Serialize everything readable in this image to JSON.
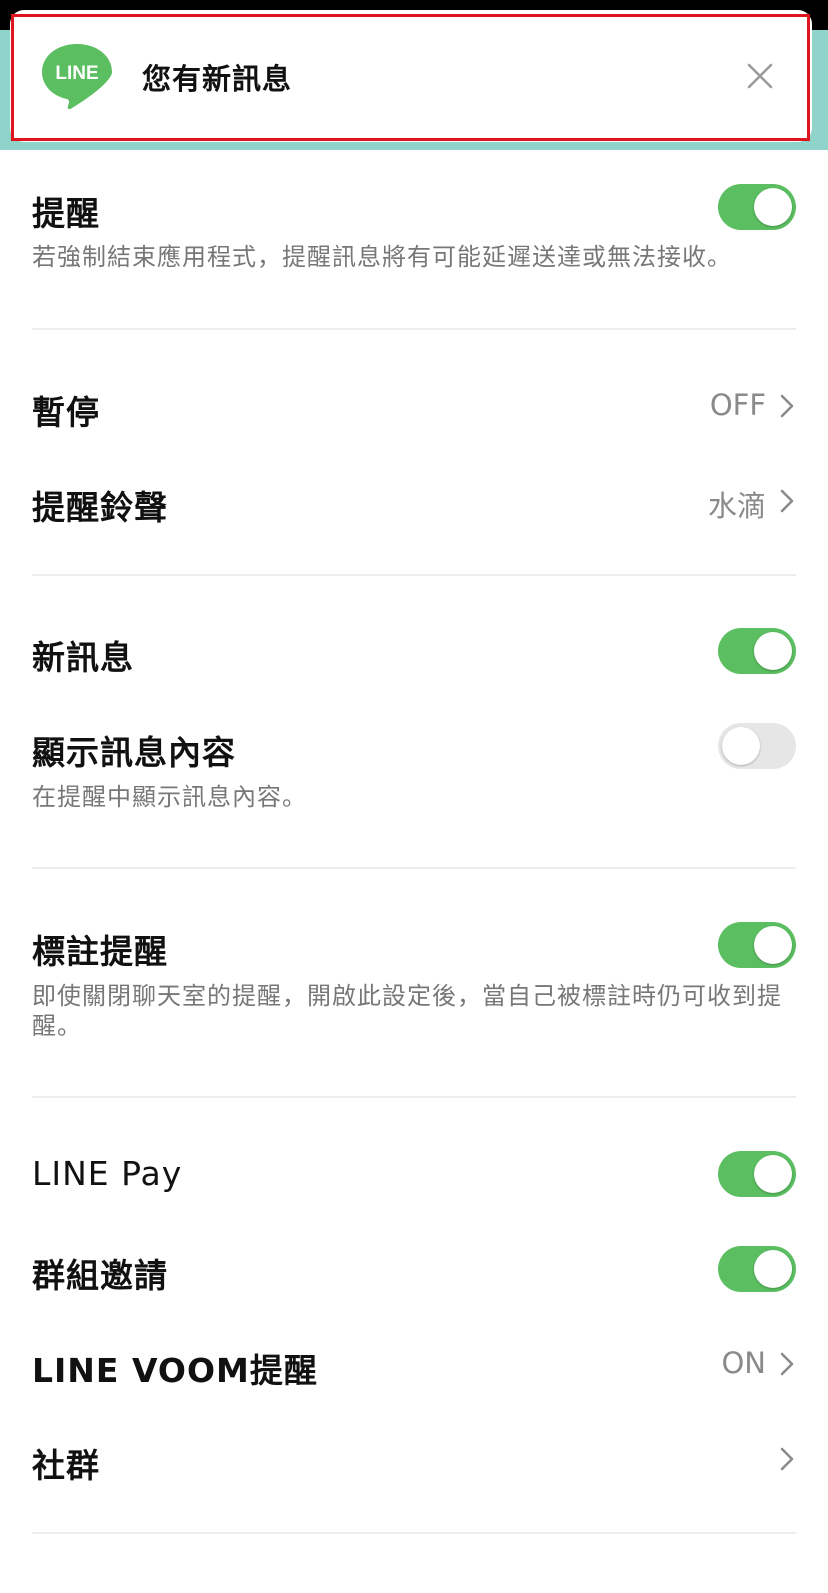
{
  "notification": {
    "app_icon": "line-logo-icon",
    "app_logo_text": "LINE",
    "message": "您有新訊息",
    "close_icon": "close-icon",
    "accent_color": "#5bbe61",
    "highlight_color": "#e0141e"
  },
  "settings": {
    "notifications": {
      "title": "提醒",
      "description": "若強制結束應用程式，提醒訊息將有可能延遲送達或無法接收。",
      "enabled": true
    },
    "pause": {
      "title": "暫停",
      "value": "OFF"
    },
    "ringtone": {
      "title": "提醒鈴聲",
      "value": "水滴"
    },
    "new_messages": {
      "title": "新訊息",
      "enabled": true
    },
    "show_message_content": {
      "title": "顯示訊息內容",
      "description": "在提醒中顯示訊息內容。",
      "enabled": false
    },
    "mention_alerts": {
      "title": "標註提醒",
      "description": "即使關閉聊天室的提醒，開啟此設定後，當自己被標註時仍可收到提醒。",
      "enabled": true
    },
    "line_pay": {
      "title": "LINE Pay",
      "enabled": true
    },
    "group_invites": {
      "title": "群組邀請",
      "enabled": true
    },
    "line_voom": {
      "title": "LINE VOOM提醒",
      "value": "ON"
    },
    "community": {
      "title": "社群",
      "value": ""
    }
  },
  "colors": {
    "toggle_on": "#5bbe61",
    "toggle_off": "#e6e6e6",
    "secondary_text": "#777777",
    "value_text": "#8a8a8a"
  }
}
